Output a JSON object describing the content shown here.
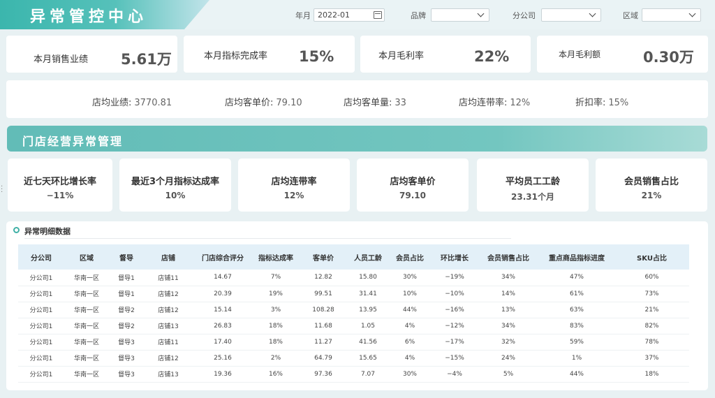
{
  "header": {
    "title": "异常管控中心",
    "filters": {
      "month_label": "年月",
      "month_value": "2022-01",
      "brand_label": "品牌",
      "brand_value": "",
      "branch_label": "分公司",
      "branch_value": "",
      "region_label": "区域",
      "region_value": ""
    }
  },
  "kpis": [
    {
      "label": "本月销售业绩",
      "value": "5.61万"
    },
    {
      "label": "本月指标完成率",
      "value": "15%"
    },
    {
      "label": "本月毛利率",
      "value": "22%"
    },
    {
      "label": "本月毛利额",
      "value": "0.30万"
    }
  ],
  "stats": [
    {
      "label": "店均业绩:",
      "value": "3770.81"
    },
    {
      "label": "店均客单价:",
      "value": "79.10"
    },
    {
      "label": "店均客单量:",
      "value": "33"
    },
    {
      "label": "店均连带率:",
      "value": "12%"
    },
    {
      "label": "折扣率:",
      "value": "15%"
    }
  ],
  "section": {
    "title": "门店经营异常管理"
  },
  "metrics": [
    {
      "label": "近七天环比增长率",
      "value": "−11%"
    },
    {
      "label": "最近3个月指标达成率",
      "value": "10%"
    },
    {
      "label": "店均连带率",
      "value": "12%"
    },
    {
      "label": "店均客单价",
      "value": "79.10"
    },
    {
      "label": "平均员工工龄",
      "value": "23.31个月"
    },
    {
      "label": "会员销售占比",
      "value": "21%"
    }
  ],
  "detail": {
    "title": "异常明细数据",
    "columns": [
      "分公司",
      "区域",
      "督导",
      "店铺",
      "门店综合评分",
      "指标达成率",
      "客单价",
      "人员工龄",
      "会员占比",
      "环比增长",
      "会员销售占比",
      "重点商品指标进度",
      "SKU占比"
    ],
    "rows": [
      [
        "分公司1",
        "华南一区",
        "督导1",
        "店铺11",
        "14.67",
        "7%",
        "12.82",
        "15.80",
        "30%",
        "−19%",
        "34%",
        "47%",
        "60%"
      ],
      [
        "分公司1",
        "华南一区",
        "督导1",
        "店铺12",
        "20.39",
        "19%",
        "99.51",
        "31.41",
        "10%",
        "−10%",
        "14%",
        "61%",
        "73%"
      ],
      [
        "分公司1",
        "华南一区",
        "督导2",
        "店铺12",
        "15.14",
        "3%",
        "108.28",
        "13.95",
        "44%",
        "−16%",
        "13%",
        "63%",
        "21%"
      ],
      [
        "分公司1",
        "华南一区",
        "督导2",
        "店铺13",
        "26.83",
        "18%",
        "11.68",
        "1.05",
        "4%",
        "−12%",
        "34%",
        "83%",
        "82%"
      ],
      [
        "分公司1",
        "华南一区",
        "督导3",
        "店铺11",
        "17.40",
        "18%",
        "11.27",
        "41.56",
        "6%",
        "−17%",
        "32%",
        "59%",
        "78%"
      ],
      [
        "分公司1",
        "华南一区",
        "督导3",
        "店铺12",
        "25.16",
        "2%",
        "64.79",
        "15.65",
        "4%",
        "−15%",
        "24%",
        "1%",
        "37%"
      ],
      [
        "分公司1",
        "华南一区",
        "督导3",
        "店铺13",
        "19.36",
        "16%",
        "97.36",
        "7.07",
        "30%",
        "−4%",
        "5%",
        "44%",
        "18%"
      ]
    ]
  }
}
